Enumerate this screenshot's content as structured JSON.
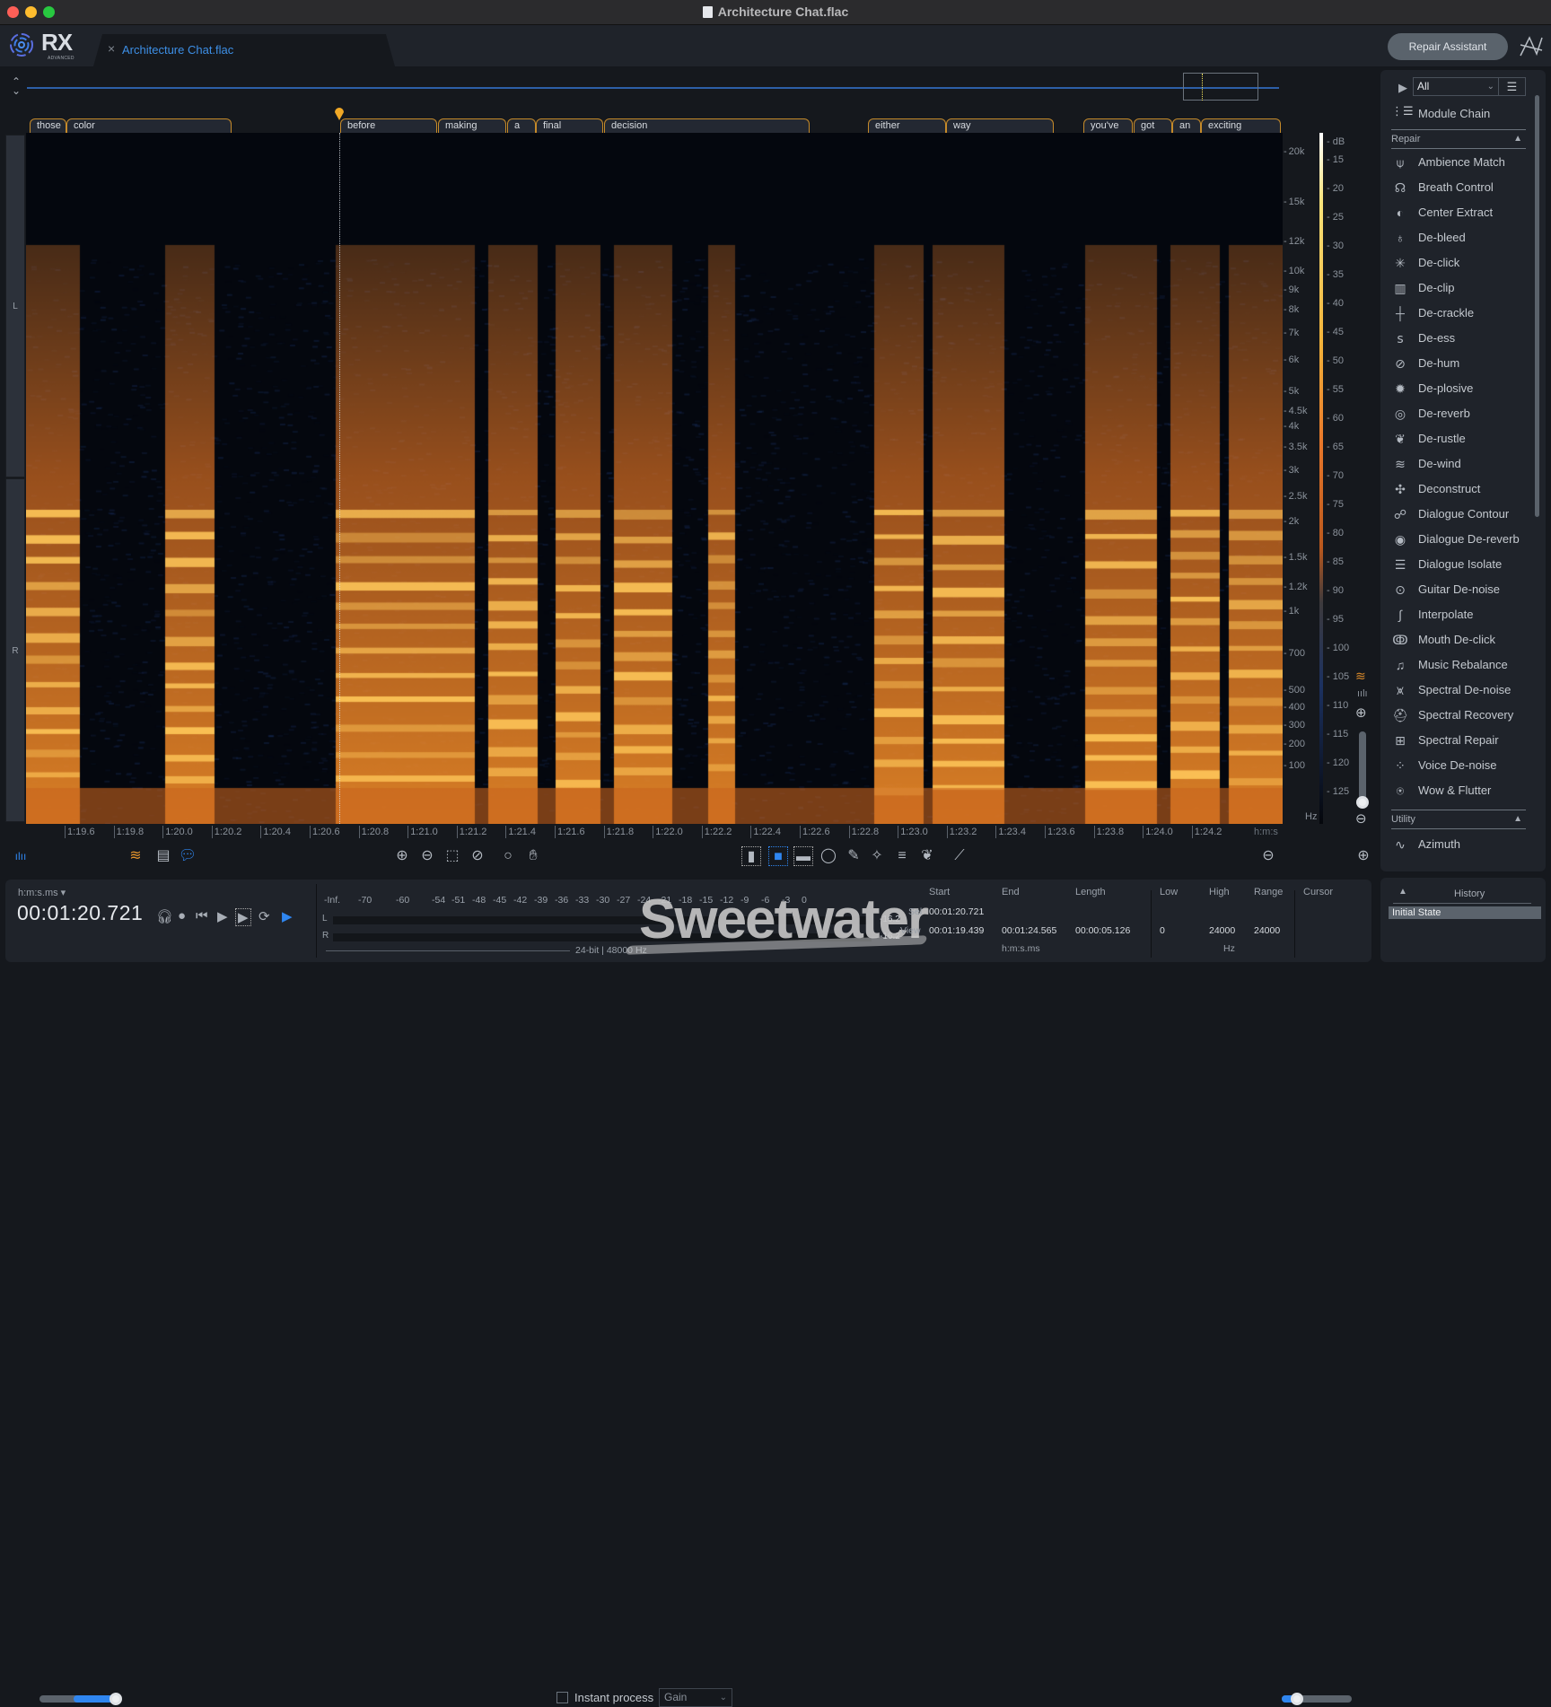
{
  "window": {
    "title": "Architecture Chat.flac"
  },
  "app": {
    "name": "RX",
    "edition": "ADVANCED",
    "file_tab": "Architecture Chat.flac",
    "close_tab": "×",
    "repair_assistant": "Repair Assistant"
  },
  "words": [
    {
      "text": "those"
    },
    {
      "text": "color"
    },
    {
      "text": "before"
    },
    {
      "text": "making"
    },
    {
      "text": "a"
    },
    {
      "text": "final"
    },
    {
      "text": "decision"
    },
    {
      "text": "either"
    },
    {
      "text": "way"
    },
    {
      "text": "you've"
    },
    {
      "text": "got"
    },
    {
      "text": "an"
    },
    {
      "text": "exciting"
    }
  ],
  "channels": {
    "left": "L",
    "right": "R"
  },
  "freq_axis": {
    "ticks": [
      "20k",
      "15k",
      "12k",
      "10k",
      "9k",
      "8k",
      "7k",
      "6k",
      "5k",
      "4.5k",
      "4k",
      "3.5k",
      "3k",
      "2.5k",
      "2k",
      "1.5k",
      "1.2k",
      "1k",
      "700",
      "500",
      "400",
      "300",
      "200",
      "100"
    ],
    "unit": "Hz"
  },
  "db_axis": {
    "label": "dB",
    "ticks": [
      "15",
      "20",
      "25",
      "30",
      "35",
      "40",
      "45",
      "50",
      "55",
      "60",
      "65",
      "70",
      "75",
      "80",
      "85",
      "90",
      "95",
      "100",
      "105",
      "110",
      "115",
      "120",
      "125"
    ]
  },
  "time_axis": {
    "ticks": [
      "1:19.6",
      "1:19.8",
      "1:20.0",
      "1:20.2",
      "1:20.4",
      "1:20.6",
      "1:20.8",
      "1:21.0",
      "1:21.2",
      "1:21.4",
      "1:21.6",
      "1:21.8",
      "1:22.0",
      "1:22.2",
      "1:22.4",
      "1:22.6",
      "1:22.8",
      "1:23.0",
      "1:23.2",
      "1:23.4",
      "1:23.6",
      "1:23.8",
      "1:24.0",
      "1:24.2"
    ],
    "unit": "h:m:s"
  },
  "toolbar": {
    "instant_process": "Instant process",
    "instant_process_checked": false,
    "gain_select": "Gain",
    "opacity_slider": 0.9,
    "zoom_slider": 0.2
  },
  "transport": {
    "time_format": "h:m:s.ms",
    "time_code": "00:01:20.721"
  },
  "meters": {
    "ticks": [
      "-Inf.",
      "-70",
      "-60",
      "-54",
      "-51",
      "-48",
      "-45",
      "-42",
      "-39",
      "-36",
      "-33",
      "-30",
      "-27",
      "-24",
      "-21",
      "-18",
      "-15",
      "-12",
      "-9",
      "-6",
      "-3",
      "0"
    ],
    "left_label": "L",
    "right_label": "R",
    "left_value": "-16.2",
    "right_value": "-16.2",
    "format": "24-bit | 48000 Hz"
  },
  "selection": {
    "headers": {
      "start": "Start",
      "end": "End",
      "length": "Length",
      "low": "Low",
      "high": "High",
      "range": "Range",
      "cursor": "Cursor"
    },
    "sel": {
      "label": "Sel",
      "start": "00:01:20.721",
      "end": "",
      "length": ""
    },
    "view": {
      "label": "View",
      "start": "00:01:19.439",
      "end": "00:01:24.565",
      "length": "00:00:05.126",
      "low": "0",
      "high": "24000",
      "range": "24000"
    },
    "time_unit": "h:m:s.ms",
    "freq_unit": "Hz"
  },
  "watermark": "Sweetwater",
  "modules": {
    "filter": "All",
    "module_chain": "Module Chain",
    "repair_header": "Repair",
    "repair": [
      {
        "label": "Ambience Match",
        "icon": "⍦"
      },
      {
        "label": "Breath Control",
        "icon": "☊"
      },
      {
        "label": "Center Extract",
        "icon": "◐"
      },
      {
        "label": "De-bleed",
        "icon": "♁"
      },
      {
        "label": "De-click",
        "icon": "✳"
      },
      {
        "label": "De-clip",
        "icon": "▥"
      },
      {
        "label": "De-crackle",
        "icon": "┼"
      },
      {
        "label": "De-ess",
        "icon": "ꜱ"
      },
      {
        "label": "De-hum",
        "icon": "⊘"
      },
      {
        "label": "De-plosive",
        "icon": "✹"
      },
      {
        "label": "De-reverb",
        "icon": "◎"
      },
      {
        "label": "De-rustle",
        "icon": "❦"
      },
      {
        "label": "De-wind",
        "icon": "≋"
      },
      {
        "label": "Deconstruct",
        "icon": "✣"
      },
      {
        "label": "Dialogue Contour",
        "icon": "☍"
      },
      {
        "label": "Dialogue De-reverb",
        "icon": "◉"
      },
      {
        "label": "Dialogue Isolate",
        "icon": "☰"
      },
      {
        "label": "Guitar De-noise",
        "icon": "⊙"
      },
      {
        "label": "Interpolate",
        "icon": "∫"
      },
      {
        "label": "Mouth De-click",
        "icon": "ↂ"
      },
      {
        "label": "Music Rebalance",
        "icon": "♫"
      },
      {
        "label": "Spectral De-noise",
        "icon": "⩙"
      },
      {
        "label": "Spectral Recovery",
        "icon": "⛑"
      },
      {
        "label": "Spectral Repair",
        "icon": "⊞"
      },
      {
        "label": "Voice De-noise",
        "icon": "⁘"
      },
      {
        "label": "Wow & Flutter",
        "icon": "⍟"
      }
    ],
    "utility_header": "Utility",
    "utility": [
      {
        "label": "Azimuth",
        "icon": "∿"
      }
    ]
  },
  "history": {
    "title": "History",
    "items": [
      "Initial State"
    ]
  }
}
